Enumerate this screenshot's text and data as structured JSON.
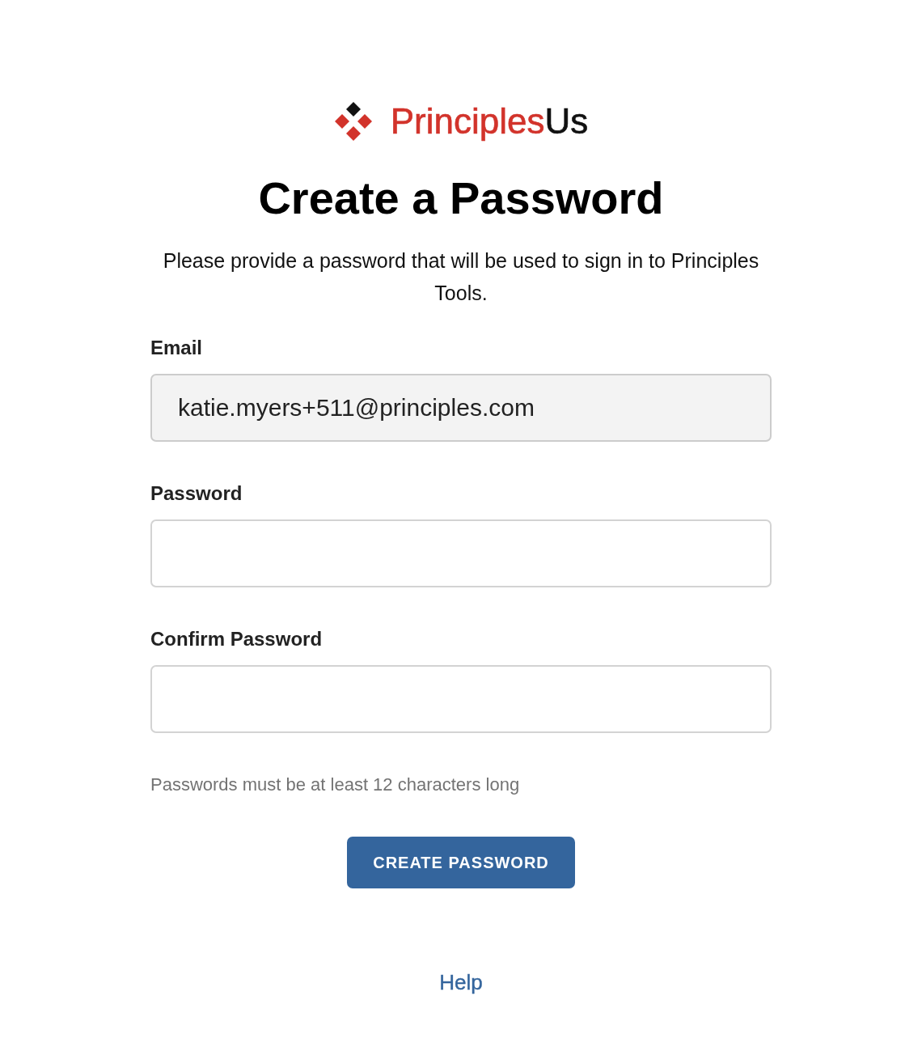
{
  "logo": {
    "brand": "Principles",
    "suffix": "Us"
  },
  "title": "Create a Password",
  "description": "Please provide a password that will be used to sign in to Principles Tools.",
  "fields": [
    {
      "label": "Email",
      "value": "katie.myers+511@principles.com",
      "disabled": true
    },
    {
      "label": "Password",
      "disabled": false
    },
    {
      "label": "Confirm Password",
      "disabled": false
    }
  ],
  "hint": "Passwords must be at least 12 characters long",
  "submit_button": "CREATE PASSWORD",
  "help_link": "Help"
}
